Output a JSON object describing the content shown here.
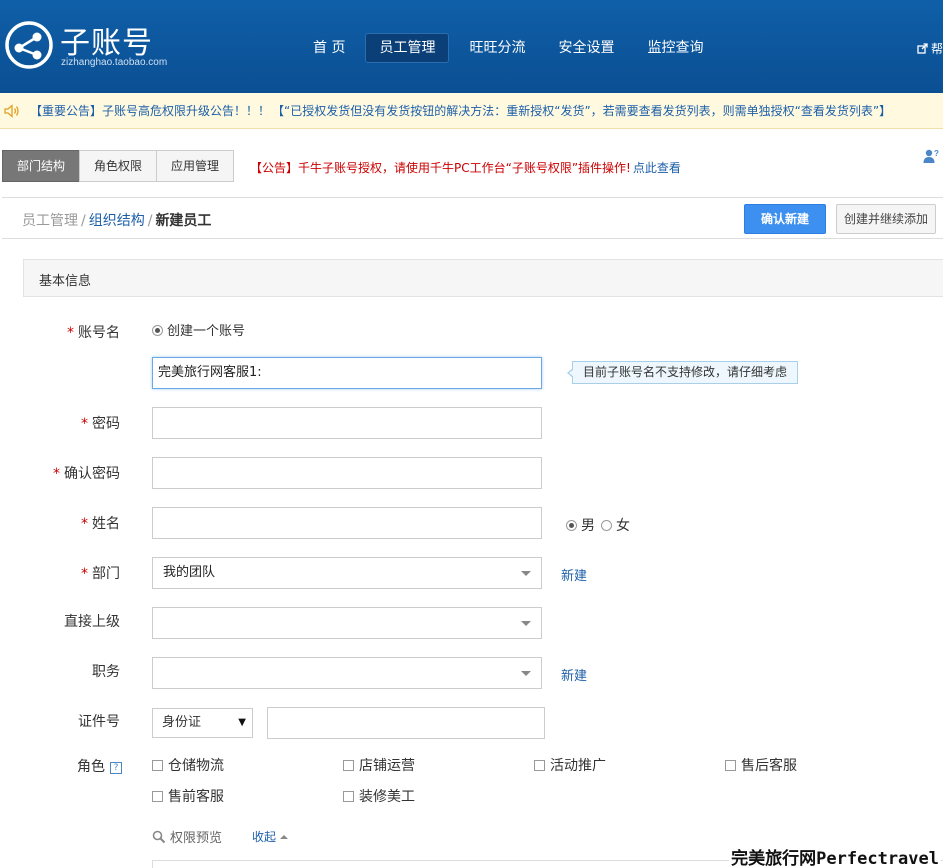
{
  "header": {
    "logo_title": "子账号",
    "logo_sub": "zizhanghao.taobao.com",
    "nav": [
      {
        "label": "首 页",
        "active": false
      },
      {
        "label": "员工管理",
        "active": true
      },
      {
        "label": "旺旺分流",
        "active": false
      },
      {
        "label": "安全设置",
        "active": false
      },
      {
        "label": "监控查询",
        "active": false
      }
    ],
    "help_label": "帮"
  },
  "notice": {
    "text1": "【重要公告】子账号高危权限升级公告！！！",
    "text2": "【“已授权发货但没有发货按钮的解决方法：重新授权“发货”，若需要查看发货列表，则需单独授权“查看发货列表”】"
  },
  "tabs": {
    "items": [
      "部门结构",
      "角色权限",
      "应用管理"
    ],
    "active_index": 0,
    "notice_red": "【公告】千牛子账号授权，请使用千牛PC工作台“子账号权限”插件操作!",
    "notice_link": "点此查看"
  },
  "breadcrumb": {
    "level1": "员工管理",
    "level2": "组织结构",
    "current": "新建员工",
    "separator": "/"
  },
  "actions": {
    "confirm": "确认新建",
    "create_continue": "创建并继续添加"
  },
  "section": {
    "title": "基本信息"
  },
  "form": {
    "required_mark": "*",
    "account": {
      "label": "账号名",
      "radio_label": "创建一个账号",
      "value": "完美旅行网客服1:",
      "tip": "目前子账号名不支持修改，请仔细考虑"
    },
    "password": {
      "label": "密码",
      "value": ""
    },
    "confirm_password": {
      "label": "确认密码",
      "value": ""
    },
    "name": {
      "label": "姓名",
      "value": "",
      "gender_male": "男",
      "gender_female": "女",
      "gender_selected": "男"
    },
    "department": {
      "label": "部门",
      "value": "我的团队",
      "new_link": "新建"
    },
    "supervisor": {
      "label": "直接上级",
      "value": ""
    },
    "position": {
      "label": "职务",
      "value": "",
      "new_link": "新建"
    },
    "id_doc": {
      "label": "证件号",
      "type": "身份证",
      "value": ""
    },
    "role": {
      "label": "角色",
      "help": "?",
      "options": [
        "仓储物流",
        "店铺运营",
        "活动推广",
        "售后客服",
        "售前客服",
        "装修美工"
      ]
    },
    "perm_preview": "权限预览",
    "collapse": "收起"
  },
  "watermark": "完美旅行网Perfectravel"
}
